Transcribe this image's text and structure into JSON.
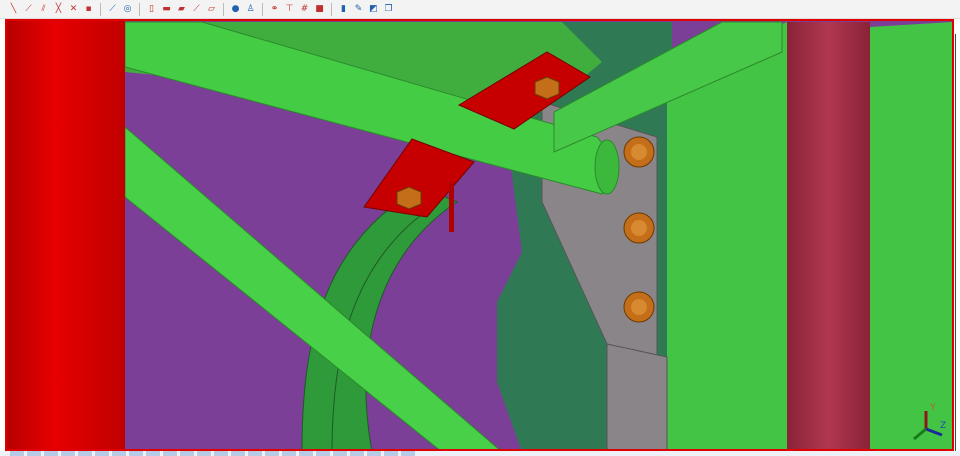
{
  "toolbar": {
    "groups": [
      [
        "line-tool-icon",
        "polyline-tool-icon",
        "double-line-icon",
        "cross-line-icon",
        "delete-line-icon",
        "point-icon"
      ],
      [
        "split-icon",
        "circle-target-icon"
      ],
      [
        "column-icon",
        "beam-icon",
        "plate-beam-icon",
        "curved-beam-icon",
        "slab-icon"
      ],
      [
        "bolt-group-icon",
        "weld-icon"
      ],
      [
        "binoculars-icon",
        "filter-icon",
        "numbering-icon",
        "box-icon"
      ],
      [
        "marker-icon",
        "drawing-icon",
        "render-icon",
        "copy-icon"
      ]
    ]
  },
  "viewport": {
    "colors": {
      "border": "#e00000",
      "red_column": "#d40000",
      "purple": "#7b3f97",
      "green": "#44c444",
      "dark_green": "#2f7a55",
      "plate": "#8a8588",
      "bolt": "#c46e1a",
      "maroon": "#a8304a"
    }
  },
  "axis": {
    "y": "Y",
    "z": "Z"
  }
}
